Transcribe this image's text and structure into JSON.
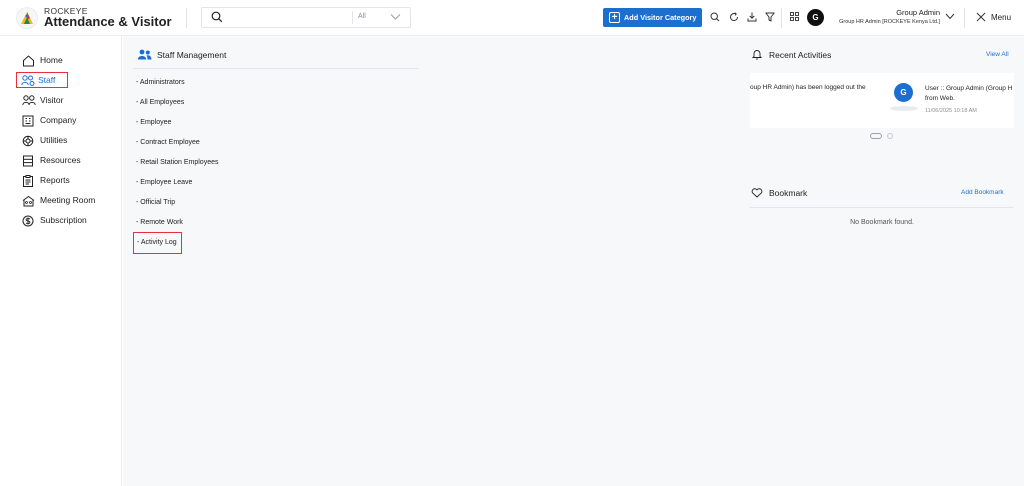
{
  "header": {
    "brand_top": "ROCKEYE",
    "brand_main": "Attendance & Visitor",
    "search": {
      "placeholder": "",
      "filter_value": "All"
    },
    "add_button_label": "Add Visitor Category",
    "user": {
      "initial": "G",
      "name": "Group Admin",
      "role": "Group HR Admin [ROCKEYE Kenya Ltd.]"
    },
    "menu_label": "Menu"
  },
  "sidebar": {
    "items": [
      {
        "label": "Home",
        "icon": "home-icon"
      },
      {
        "label": "Staff",
        "icon": "staff-icon",
        "active": true
      },
      {
        "label": "Visitor",
        "icon": "visitor-icon"
      },
      {
        "label": "Company",
        "icon": "company-icon"
      },
      {
        "label": "Utilities",
        "icon": "utilities-icon"
      },
      {
        "label": "Resources",
        "icon": "resources-icon"
      },
      {
        "label": "Reports",
        "icon": "reports-icon"
      },
      {
        "label": "Meeting Room",
        "icon": "meeting-room-icon"
      },
      {
        "label": "Subscription",
        "icon": "subscription-icon"
      }
    ]
  },
  "staff_management": {
    "title": "Staff Management",
    "links": [
      "- Administrators",
      "- All Employees",
      "- Employee",
      "- Contract Employee",
      "- Retail Station Employees",
      "- Employee Leave",
      "- Official Trip",
      "- Remote Work",
      "- Activity Log"
    ],
    "active_link_index": 8
  },
  "recent_activities": {
    "title": "Recent Activities",
    "view_all_label": "View All",
    "activity_prev_text": "oup HR Admin) has been logged out the",
    "activity_avatar": "G",
    "activity_text_line1": "User :: Group Admin (Group H",
    "activity_text_line2": "from Web.",
    "activity_time": "11/06/2025 10:18 AM"
  },
  "bookmark": {
    "title": "Bookmark",
    "add_label": "Add Bookmark",
    "empty_text": "No Bookmark found."
  },
  "colors": {
    "accent": "#1d6fcf",
    "highlight_border": "#e8303a",
    "background": "#f7f8fa"
  }
}
